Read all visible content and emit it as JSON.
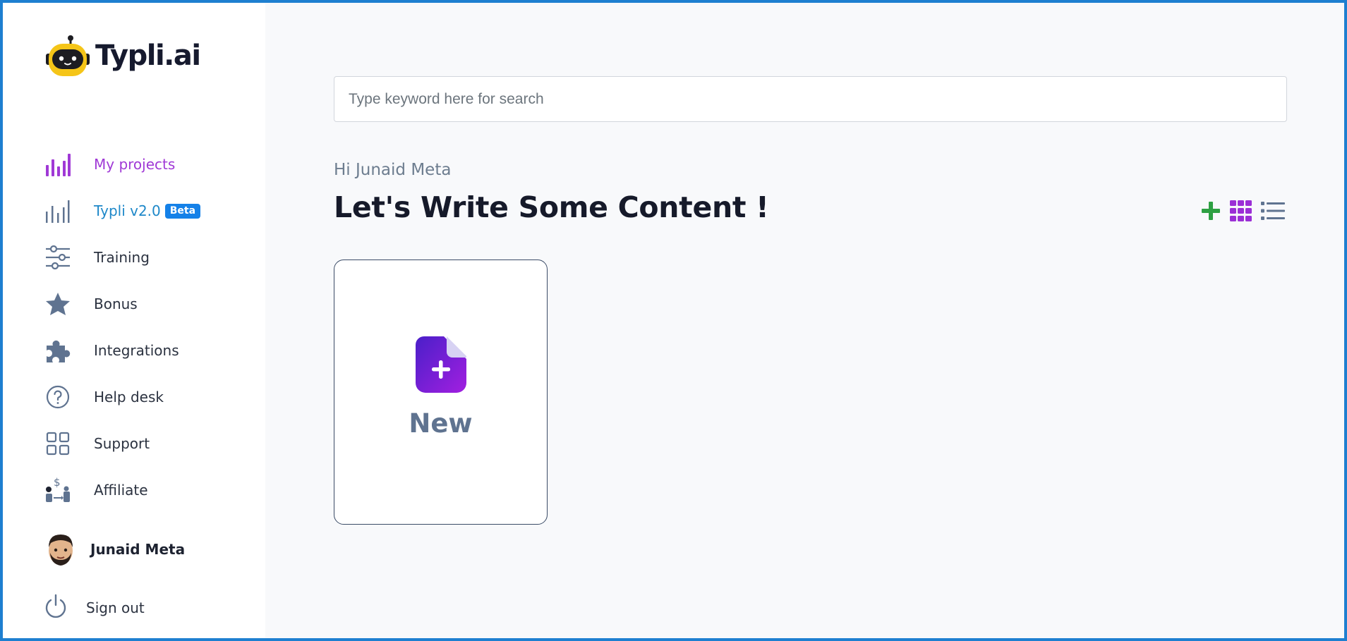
{
  "brand": {
    "name": "Typli.ai"
  },
  "sidebar": {
    "items": [
      {
        "label": "My projects",
        "icon": "bar-chart-icon",
        "active": true
      },
      {
        "label": "Typli v2.0",
        "icon": "bar-chart-outline-icon",
        "badge": "Beta"
      },
      {
        "label": "Training",
        "icon": "sliders-icon"
      },
      {
        "label": "Bonus",
        "icon": "star-icon"
      },
      {
        "label": "Integrations",
        "icon": "puzzle-icon"
      },
      {
        "label": "Help desk",
        "icon": "question-circle-icon"
      },
      {
        "label": "Support",
        "icon": "grid-icon"
      },
      {
        "label": "Affiliate",
        "icon": "affiliate-icon"
      }
    ],
    "user": {
      "name": "Junaid Meta",
      "icon": "avatar"
    },
    "signout": {
      "label": "Sign out",
      "icon": "power-icon"
    }
  },
  "main": {
    "search": {
      "placeholder": "Type keyword here for search",
      "value": ""
    },
    "greeting": "Hi Junaid Meta",
    "headline": "Let's Write Some Content !",
    "view_toggles": [
      {
        "name": "add-project-icon",
        "color": "#2ea043"
      },
      {
        "name": "grid-view-icon",
        "color": "#9b2fd6",
        "active": true
      },
      {
        "name": "list-view-icon",
        "color": "#5f7390"
      }
    ],
    "new_card": {
      "label": "New",
      "icon": "new-document-icon"
    }
  },
  "colors": {
    "accent_purple": "#a039d6",
    "link_blue": "#1e88c9",
    "badge_blue": "#1581e8",
    "frame_blue": "#1e7fd0",
    "icon_slate": "#5f7390"
  }
}
